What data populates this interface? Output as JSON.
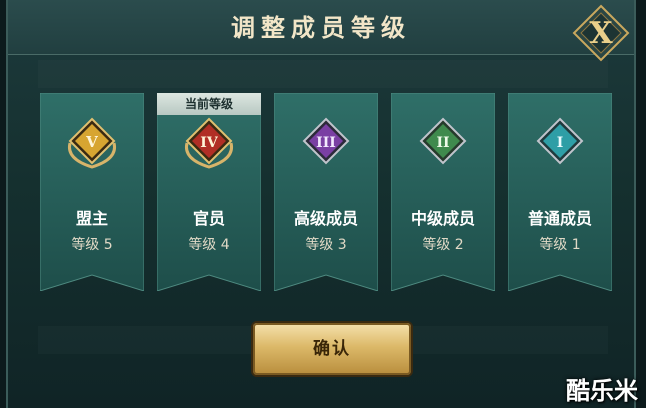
{
  "dialog": {
    "title": "调整成员等级",
    "close_label": "X",
    "current_tag": "当前等级",
    "confirm_label": "确认"
  },
  "ranks": [
    {
      "numeral": "V",
      "role": "盟主",
      "level": "等级 5",
      "gem_color": "#d7a531",
      "is_current": false
    },
    {
      "numeral": "IV",
      "role": "官员",
      "level": "等级 4",
      "gem_color": "#b12e25",
      "is_current": true
    },
    {
      "numeral": "III",
      "role": "高级成员",
      "level": "等级 3",
      "gem_color": "#7a3fa3",
      "is_current": false
    },
    {
      "numeral": "II",
      "role": "中级成员",
      "level": "等级 2",
      "gem_color": "#3f8a4d",
      "is_current": false
    },
    {
      "numeral": "I",
      "role": "普通成员",
      "level": "等级 1",
      "gem_color": "#2e9ea6",
      "is_current": false
    }
  ],
  "watermark": "酷乐米",
  "colors": {
    "banner": "#2c6a63",
    "banner_dark": "#1d4b47",
    "gold": "#d7b46a",
    "accent_text": "#f2e6c8"
  }
}
